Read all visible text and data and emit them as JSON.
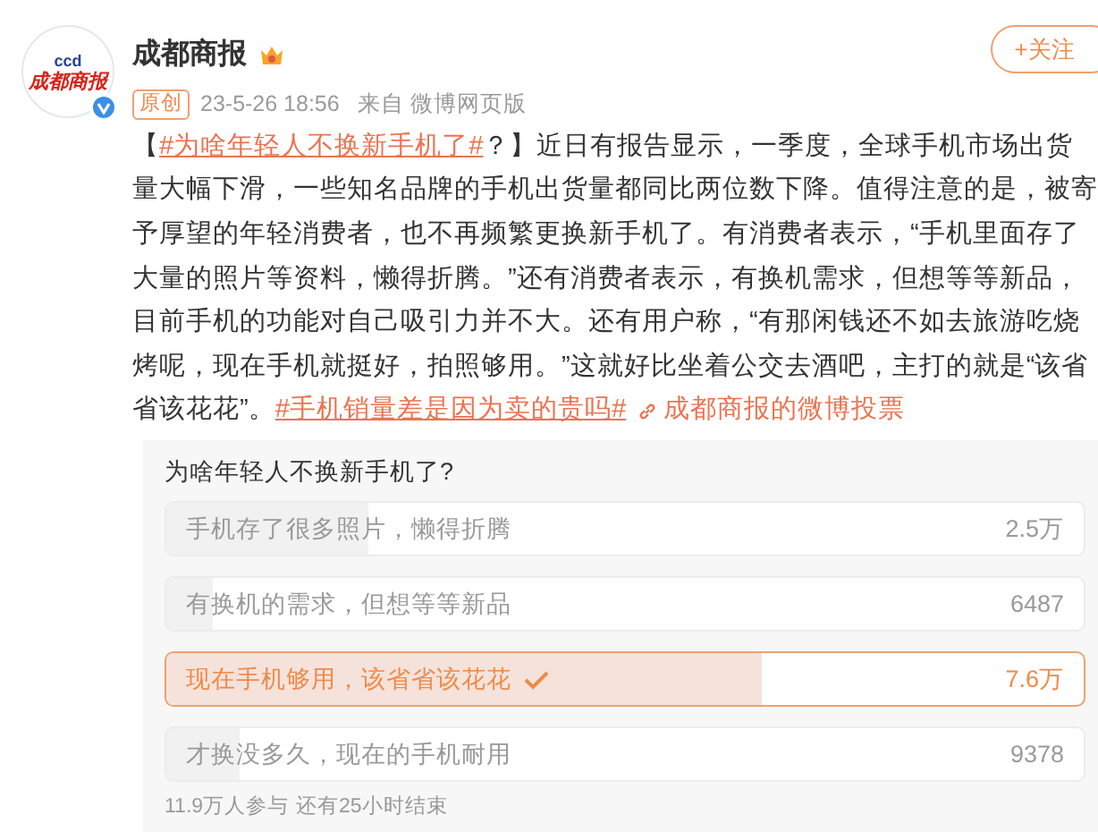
{
  "author": {
    "name": "成都商报",
    "logo_mark": "ccd",
    "logo_text": "成都商报",
    "verified": true,
    "badge": "原创",
    "time": "23-5-26 18:56",
    "source": "来自 微博网页版"
  },
  "follow_button": "+关注",
  "body_lines": [
    [
      {
        "kind": "text",
        "text": "【"
      },
      {
        "kind": "hashtag",
        "text": "#为啥年轻人不换新手机了#"
      },
      {
        "kind": "text",
        "text": "？】近日有报告显示，一季度，全球手机市场出货"
      }
    ],
    [
      {
        "kind": "text",
        "text": "量大幅下滑，一些知名品牌的手机出货量都同比两位数下降。值得注意的是，被寄"
      }
    ],
    [
      {
        "kind": "text",
        "text": "予厚望的年轻消费者，也不再频繁更换新手机了。有消费者表示，“手机里面存了"
      }
    ],
    [
      {
        "kind": "text",
        "text": "大量的照片等资料，懒得折腾。”还有消费者表示，有换机需求，但想等等新品，"
      }
    ],
    [
      {
        "kind": "text",
        "text": "目前手机的功能对自己吸引力并不大。还有用户称，“有那闲钱还不如去旅游吃烧"
      }
    ],
    [
      {
        "kind": "text",
        "text": "烤呢，现在手机就挺好，拍照够用。”这就好比坐着公交去酒吧，主打的就是“该省"
      }
    ],
    [
      {
        "kind": "text",
        "text": "省该花花”。"
      },
      {
        "kind": "hashtag",
        "text": "#手机销量差是因为卖的贵吗#"
      },
      {
        "kind": "link",
        "text": "成都商报的微博投票"
      }
    ]
  ],
  "poll": {
    "title": "为啥年轻人不换新手机了?",
    "options": [
      {
        "label": "手机存了很多照片，懒得折腾",
        "count": "2.5万",
        "level": 0.22,
        "selected": false
      },
      {
        "label": "有换机的需求，但想等等新品",
        "count": "6487",
        "level": 0.05,
        "selected": false
      },
      {
        "label": "现在手机够用，该省省该花花",
        "count": "7.6万",
        "level": 0.65,
        "selected": true
      },
      {
        "label": "才换没多久，现在的手机耐用",
        "count": "9378",
        "level": 0.08,
        "selected": false
      }
    ],
    "participants": "11.9万人参与",
    "remaining": "还有25小时结束"
  }
}
